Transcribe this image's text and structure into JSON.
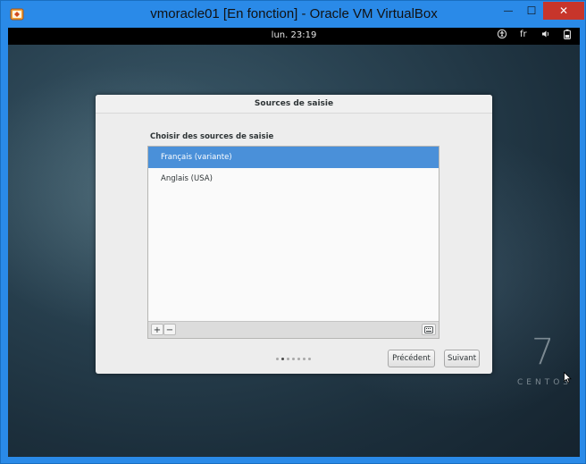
{
  "window": {
    "title": "vmoracle01 [En fonction] - Oracle VM VirtualBox",
    "minimize": "—",
    "maximize": "☐",
    "close": "✕"
  },
  "topbar": {
    "clock": "lun. 23:19",
    "keyboard_layout": "fr"
  },
  "dialog": {
    "title": "Sources de saisie",
    "section_title": "Choisir des sources de saisie",
    "sources": [
      {
        "label": "Français (variante)",
        "selected": true
      },
      {
        "label": "Anglais (USA)",
        "selected": false
      }
    ],
    "add_label": "+",
    "remove_label": "−",
    "page_count": 7,
    "current_page": 2,
    "previous_label": "Précédent",
    "next_label": "Suivant"
  },
  "branding": {
    "number": "7",
    "word": "CENTOS"
  },
  "colors": {
    "selection": "#4a90d9",
    "window_frame": "#2a8ae8",
    "close_button": "#c7352b"
  }
}
